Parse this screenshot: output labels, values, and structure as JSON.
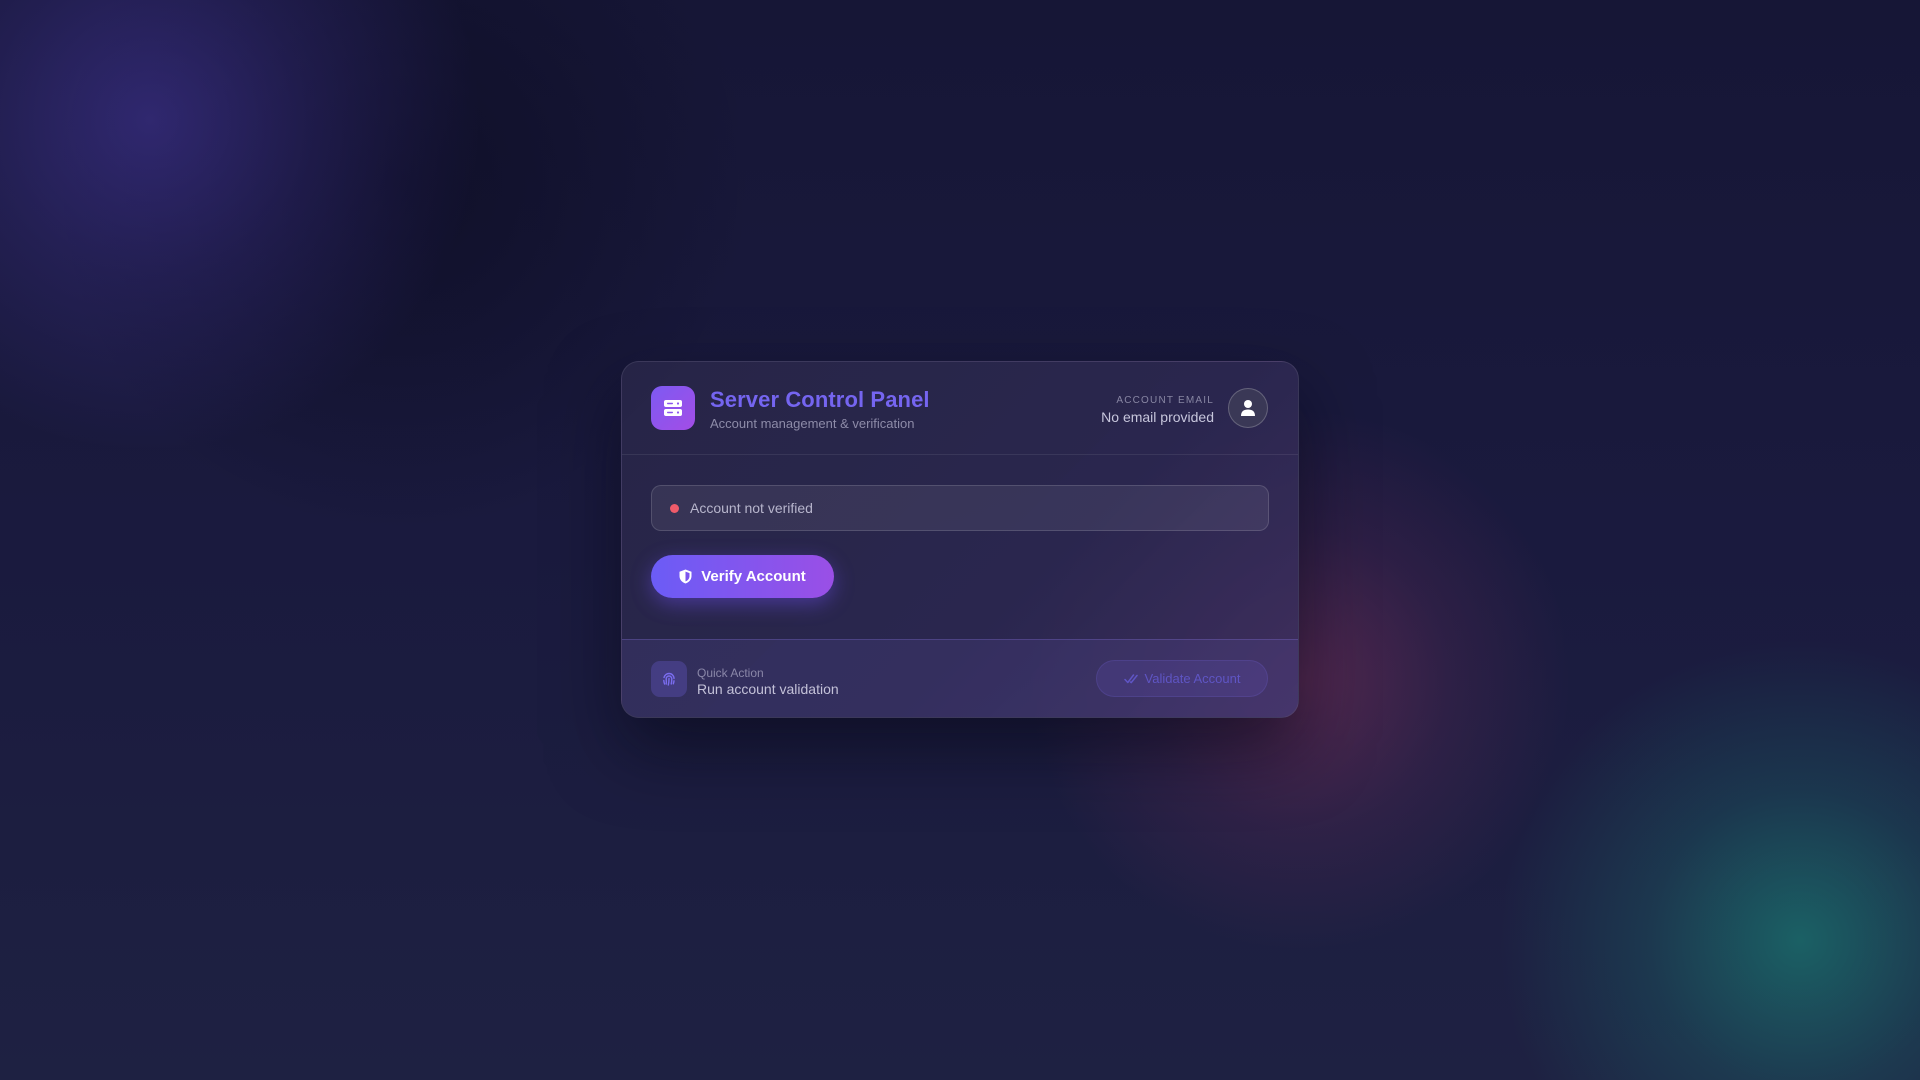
{
  "header": {
    "title": "Server Control Panel",
    "subtitle": "Account management & verification",
    "logo_icon": "server-icon",
    "account_label": "ACCOUNT EMAIL",
    "account_email": "No email provided",
    "avatar_icon": "user-icon"
  },
  "status": {
    "text": "Account not verified",
    "dot_color": "#ef5b6a"
  },
  "verify": {
    "label": "Verify Account",
    "icon": "shield-icon"
  },
  "quick_action": {
    "label": "Quick Action",
    "text": "Run account validation",
    "icon": "fingerprint-icon",
    "button_label": "Validate Account",
    "button_icon": "check-double-icon"
  },
  "colors": {
    "accent": "#6b5cf6",
    "accent_end": "#9a4fe6",
    "title": "#7565f0",
    "background": "#181838"
  }
}
